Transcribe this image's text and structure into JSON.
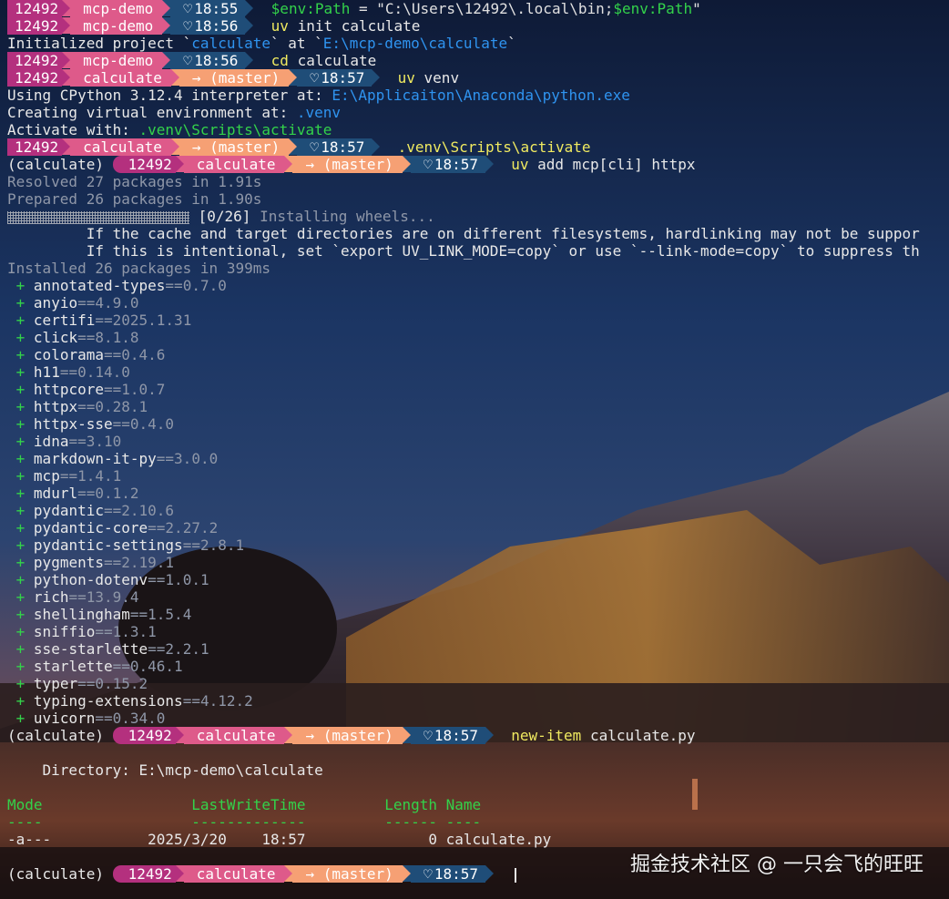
{
  "colors": {
    "user_seg": "#b4307e",
    "dir_seg": "#de5a8a",
    "git_seg": "#f6a074",
    "time_seg": "#1f4d78",
    "cmd_yellow": "#f0ea60",
    "path_blue": "#2f94f0",
    "pkg_plus": "#33d24a"
  },
  "prompts": [
    {
      "user": "12492",
      "dir": "mcp-demo",
      "time": "18:55"
    },
    {
      "user": "12492",
      "dir": "mcp-demo",
      "time": "18:56"
    },
    {
      "user": "12492",
      "dir": "mcp-demo",
      "time": "18:56"
    },
    {
      "user": "12492",
      "dir": "calculate",
      "git": "→ (master)",
      "time": "18:57"
    },
    {
      "user": "12492",
      "dir": "calculate",
      "git": "→ (master)",
      "time": "18:57"
    },
    {
      "env": "(calculate)",
      "user": "12492",
      "dir": "calculate",
      "git": "→ (master)",
      "time": "18:57"
    },
    {
      "env": "(calculate)",
      "user": "12492",
      "dir": "calculate",
      "git": "→ (master)",
      "time": "18:57"
    },
    {
      "env": "(calculate)",
      "user": "12492",
      "dir": "calculate",
      "git": "→ (master)",
      "time": "18:57"
    }
  ],
  "cmd1": {
    "var1": "$env:Path",
    "eq": " = ",
    "str": "\"C:\\Users\\12492\\.local\\bin;",
    "var2": "$env:Path",
    "end": "\""
  },
  "cmd2": {
    "prog": "uv",
    "args": " init calculate"
  },
  "out_init": {
    "pre": "Initialized project `",
    "name": "calculate",
    "mid": "` at `",
    "path": "E:\\mcp-demo\\calculate",
    "end": "`"
  },
  "cmd3": {
    "prog": "cd",
    "args": " calculate"
  },
  "cmd4": {
    "prog": "uv",
    "args": " venv"
  },
  "out_venv": {
    "l1_pre": "Using CPython 3.12.4 interpreter at: ",
    "l1_path": "E:\\Applicaiton\\Anaconda\\python.exe",
    "l2_pre": "Creating virtual environment at: ",
    "l2_path": ".venv",
    "l3_pre": "Activate with: ",
    "l3_cmd": ".venv\\Scripts\\activate"
  },
  "cmd5": {
    "text": ".venv\\Scripts\\activate"
  },
  "cmd6": {
    "prog": "uv",
    "args": " add mcp[cli] httpx"
  },
  "out_add": {
    "resolved_a": "Resolved ",
    "resolved_n": "27",
    "resolved_b": " packages in 1.91s",
    "prepared_a": "Prepared ",
    "prepared_n": "26",
    "prepared_b": " packages in 1.90s",
    "progress": "[0/26]",
    "progress_text": " Installing wheels...",
    "warn1": "         If the cache and target directories are on different filesystems, hardlinking may not be suppor",
    "warn2": "         If this is intentional, set `export UV_LINK_MODE=copy` or use `--link-mode=copy` to suppress th",
    "installed_a": "Installed ",
    "installed_n": "26",
    "installed_b": " packages in 399ms"
  },
  "packages": [
    {
      "name": "annotated-types",
      "version": "==0.7.0"
    },
    {
      "name": "anyio",
      "version": "==4.9.0"
    },
    {
      "name": "certifi",
      "version": "==2025.1.31"
    },
    {
      "name": "click",
      "version": "==8.1.8"
    },
    {
      "name": "colorama",
      "version": "==0.4.6"
    },
    {
      "name": "h11",
      "version": "==0.14.0"
    },
    {
      "name": "httpcore",
      "version": "==1.0.7"
    },
    {
      "name": "httpx",
      "version": "==0.28.1"
    },
    {
      "name": "httpx-sse",
      "version": "==0.4.0"
    },
    {
      "name": "idna",
      "version": "==3.10"
    },
    {
      "name": "markdown-it-py",
      "version": "==3.0.0"
    },
    {
      "name": "mcp",
      "version": "==1.4.1"
    },
    {
      "name": "mdurl",
      "version": "==0.1.2"
    },
    {
      "name": "pydantic",
      "version": "==2.10.6"
    },
    {
      "name": "pydantic-core",
      "version": "==2.27.2"
    },
    {
      "name": "pydantic-settings",
      "version": "==2.8.1"
    },
    {
      "name": "pygments",
      "version": "==2.19.1"
    },
    {
      "name": "python-dotenv",
      "version": "==1.0.1"
    },
    {
      "name": "rich",
      "version": "==13.9.4"
    },
    {
      "name": "shellingham",
      "version": "==1.5.4"
    },
    {
      "name": "sniffio",
      "version": "==1.3.1"
    },
    {
      "name": "sse-starlette",
      "version": "==2.2.1"
    },
    {
      "name": "starlette",
      "version": "==0.46.1"
    },
    {
      "name": "typer",
      "version": "==0.15.2"
    },
    {
      "name": "typing-extensions",
      "version": "==4.12.2"
    },
    {
      "name": "uvicorn",
      "version": "==0.34.0"
    }
  ],
  "cmd7": {
    "prog": "new-item",
    "args": " calculate.py"
  },
  "dir_listing": {
    "directory": "    Directory: E:\\mcp-demo\\calculate",
    "header": "Mode                 LastWriteTime         Length Name",
    "underline": "----                 -------------         ------ ----",
    "row": "-a---           2025/3/20    18:57              0 calculate.py"
  },
  "watermark": "掘金技术社区 @ 一只会飞的旺旺"
}
